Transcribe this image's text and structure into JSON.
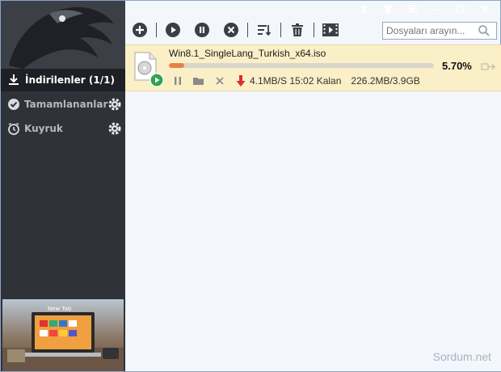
{
  "sidebar": {
    "active_item": "İndirilenler (1/1)",
    "items": [
      {
        "label": "Tamamlananlar"
      },
      {
        "label": "Kuyruk"
      }
    ],
    "ad_label": "New Tab"
  },
  "search": {
    "placeholder": "Dosyaları arayın..."
  },
  "download": {
    "filename": "Win8.1_SingleLang_Turkish_x64.iso",
    "progress_percent": 5.7,
    "percent_label": "5.70%",
    "speed_text": "4.1MB/S 15:02 Kalan",
    "size_text": "226.2MB/3.9GB"
  },
  "watermark": "Sordum.net",
  "colors": {
    "sidebar_bg": "#2f3239",
    "row_highlight": "#fbefc7",
    "progress_fill": "#e8804a",
    "play_green": "#2ea44f",
    "speed_arrow_red": "#d9302a"
  },
  "icons": {
    "toolbar": [
      "add-icon",
      "start-icon",
      "pause-icon",
      "cancel-icon",
      "sort-icon",
      "delete-icon",
      "media-icon"
    ],
    "titlebar": [
      "dollar-icon",
      "shirt-icon",
      "skin-icon",
      "minimize-icon",
      "maximize-icon",
      "close-icon"
    ]
  }
}
